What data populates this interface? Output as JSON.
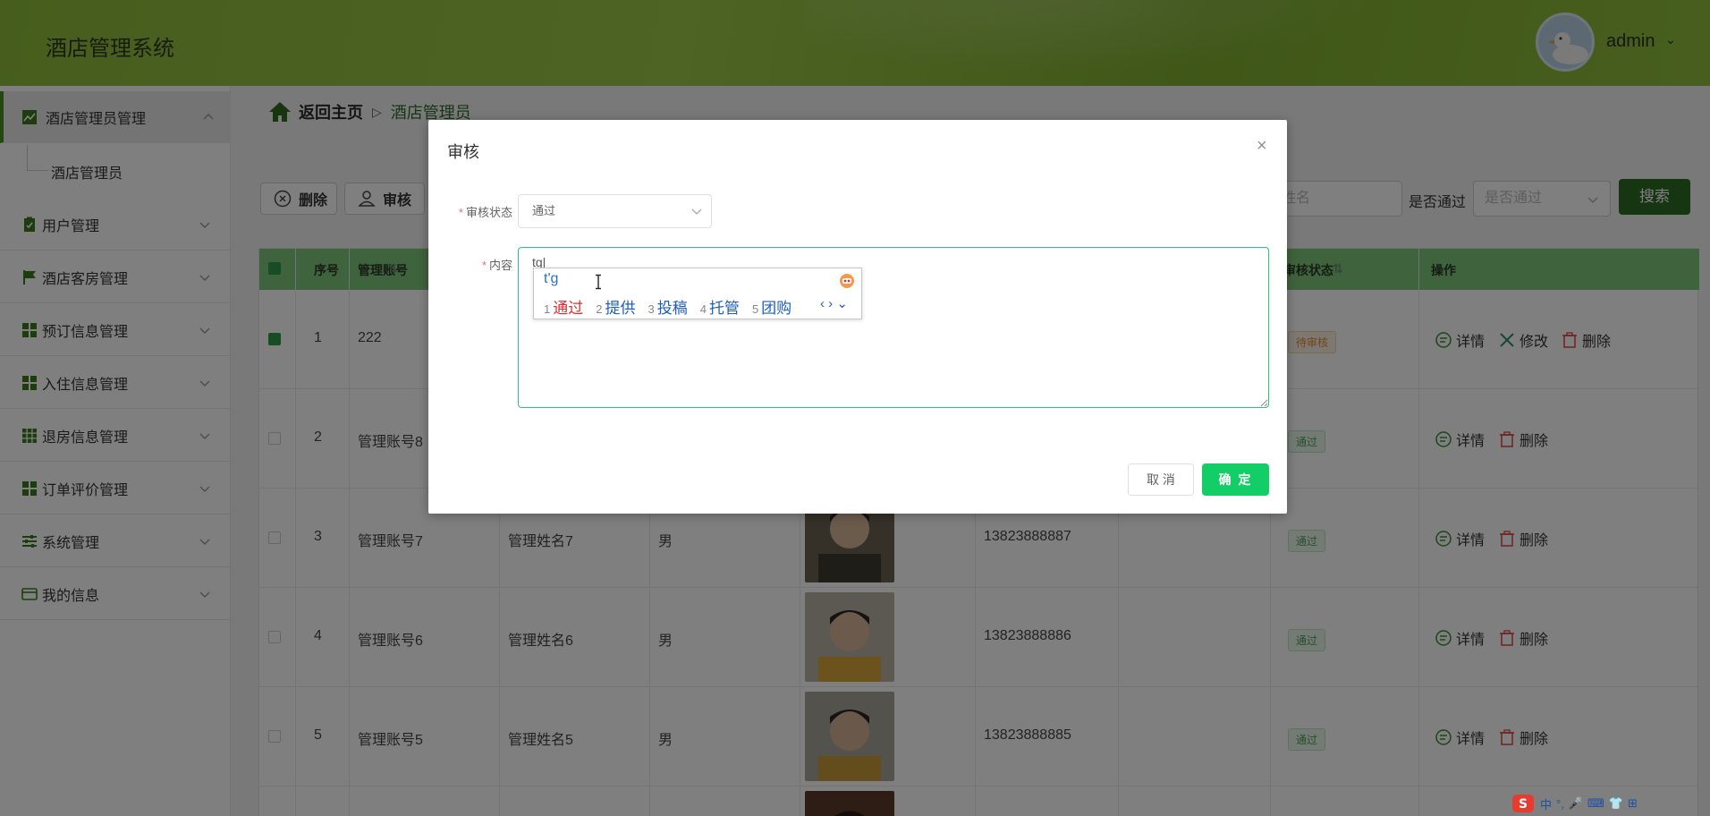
{
  "app": {
    "title": "酒店管理系统"
  },
  "user": {
    "name": "admin"
  },
  "sidebar": {
    "items": [
      {
        "label": "酒店管理员管理",
        "icon": "chart-icon"
      },
      {
        "label": "酒店管理员",
        "icon": ""
      },
      {
        "label": "用户管理",
        "icon": "clipboard-icon"
      },
      {
        "label": "酒店客房管理",
        "icon": "flag-icon"
      },
      {
        "label": "预订信息管理",
        "icon": "grid-icon"
      },
      {
        "label": "入住信息管理",
        "icon": "grid-icon"
      },
      {
        "label": "退房信息管理",
        "icon": "grid-icon"
      },
      {
        "label": "订单评价管理",
        "icon": "grid-icon"
      },
      {
        "label": "系统管理",
        "icon": "sliders-icon"
      },
      {
        "label": "我的信息",
        "icon": "card-icon"
      }
    ]
  },
  "breadcrumb": {
    "home": "返回主页",
    "current": "酒店管理员"
  },
  "toolbar": {
    "delete_label": "删除",
    "audit_label": "审核"
  },
  "search": {
    "name_placeholder": "姓名",
    "pass_label": "是否通过",
    "pass_placeholder": "是否通过",
    "button_label": "搜索"
  },
  "table": {
    "headers": [
      "序号",
      "管理账号",
      "审核状态",
      "操作"
    ],
    "rows": [
      {
        "index": "1",
        "account": "222",
        "name": "",
        "gender": "",
        "phone": "",
        "status": "待审核",
        "ops": [
          "详情",
          "修改",
          "删除"
        ]
      },
      {
        "index": "2",
        "account": "管理账号8",
        "name": "",
        "gender": "",
        "phone": "",
        "status": "通过",
        "ops": [
          "详情",
          "删除"
        ]
      },
      {
        "index": "3",
        "account": "管理账号7",
        "name": "管理姓名7",
        "gender": "男",
        "phone": "13823888887",
        "status": "通过",
        "ops": [
          "详情",
          "删除"
        ]
      },
      {
        "index": "4",
        "account": "管理账号6",
        "name": "管理姓名6",
        "gender": "男",
        "phone": "13823888886",
        "status": "通过",
        "ops": [
          "详情",
          "删除"
        ]
      },
      {
        "index": "5",
        "account": "管理账号5",
        "name": "管理姓名5",
        "gender": "男",
        "phone": "13823888885",
        "status": "通过",
        "ops": [
          "详情",
          "删除"
        ]
      }
    ]
  },
  "dialog": {
    "title": "审核",
    "status_label": "审核状态",
    "status_value": "通过",
    "content_label": "内容",
    "content_value": "t'g",
    "cancel_label": "取 消",
    "ok_label": "确 定"
  },
  "ime": {
    "input": "t'g",
    "candidates": [
      {
        "n": "1",
        "text": "通过"
      },
      {
        "n": "2",
        "text": "提供"
      },
      {
        "n": "3",
        "text": "投稿"
      },
      {
        "n": "4",
        "text": "托管"
      },
      {
        "n": "5",
        "text": "团购"
      }
    ]
  },
  "tray": {
    "items": [
      "中",
      "°,",
      "🎤",
      "⌨",
      "👕",
      "⊞"
    ]
  },
  "colors": {
    "accent": "#13ce66",
    "header": "#8dbb3a",
    "search_button": "#2d6b22"
  }
}
